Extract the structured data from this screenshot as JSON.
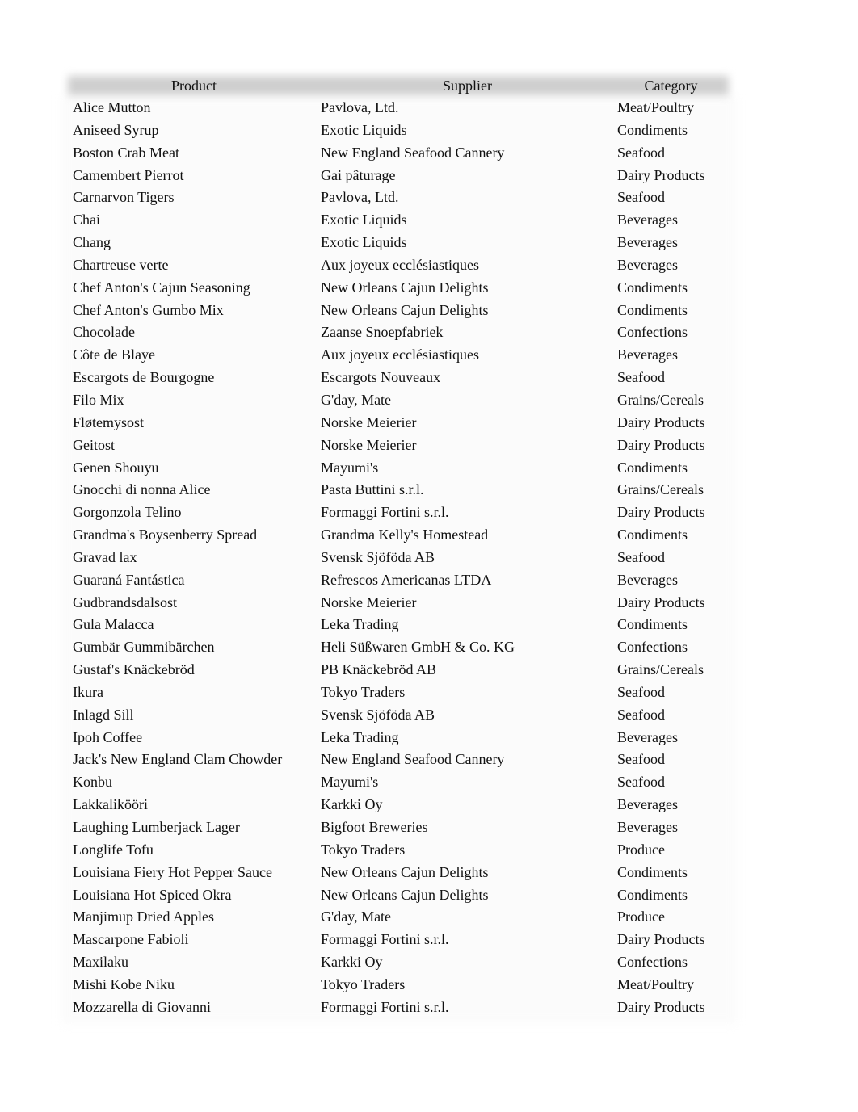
{
  "table": {
    "headers": [
      "Product",
      "Supplier",
      "Category"
    ],
    "rows": [
      [
        "Alice Mutton",
        "Pavlova, Ltd.",
        "Meat/Poultry"
      ],
      [
        "Aniseed Syrup",
        "Exotic Liquids",
        "Condiments"
      ],
      [
        "Boston Crab Meat",
        "New England Seafood Cannery",
        "Seafood"
      ],
      [
        "Camembert Pierrot",
        "Gai pâturage",
        "Dairy Products"
      ],
      [
        "Carnarvon Tigers",
        "Pavlova, Ltd.",
        "Seafood"
      ],
      [
        "Chai",
        "Exotic Liquids",
        "Beverages"
      ],
      [
        "Chang",
        "Exotic Liquids",
        "Beverages"
      ],
      [
        "Chartreuse verte",
        "Aux joyeux ecclésiastiques",
        "Beverages"
      ],
      [
        "Chef Anton's Cajun Seasoning",
        "New Orleans Cajun Delights",
        "Condiments"
      ],
      [
        "Chef Anton's Gumbo Mix",
        "New Orleans Cajun Delights",
        "Condiments"
      ],
      [
        "Chocolade",
        "Zaanse Snoepfabriek",
        "Confections"
      ],
      [
        "Côte de Blaye",
        "Aux joyeux ecclésiastiques",
        "Beverages"
      ],
      [
        "Escargots de Bourgogne",
        "Escargots Nouveaux",
        "Seafood"
      ],
      [
        "Filo Mix",
        "G'day, Mate",
        "Grains/Cereals"
      ],
      [
        "Fløtemysost",
        "Norske Meierier",
        "Dairy Products"
      ],
      [
        "Geitost",
        "Norske Meierier",
        "Dairy Products"
      ],
      [
        "Genen Shouyu",
        "Mayumi's",
        "Condiments"
      ],
      [
        "Gnocchi di nonna Alice",
        "Pasta Buttini s.r.l.",
        "Grains/Cereals"
      ],
      [
        "Gorgonzola Telino",
        "Formaggi Fortini s.r.l.",
        "Dairy Products"
      ],
      [
        "Grandma's Boysenberry Spread",
        "Grandma Kelly's Homestead",
        "Condiments"
      ],
      [
        "Gravad lax",
        "Svensk Sjöföda AB",
        "Seafood"
      ],
      [
        "Guaraná Fantástica",
        "Refrescos Americanas LTDA",
        "Beverages"
      ],
      [
        "Gudbrandsdalsost",
        "Norske Meierier",
        "Dairy Products"
      ],
      [
        "Gula Malacca",
        "Leka Trading",
        "Condiments"
      ],
      [
        "Gumbär Gummibärchen",
        "Heli Süßwaren GmbH & Co. KG",
        "Confections"
      ],
      [
        "Gustaf's Knäckebröd",
        "PB Knäckebröd AB",
        "Grains/Cereals"
      ],
      [
        "Ikura",
        "Tokyo Traders",
        "Seafood"
      ],
      [
        "Inlagd Sill",
        "Svensk Sjöföda AB",
        "Seafood"
      ],
      [
        "Ipoh Coffee",
        "Leka Trading",
        "Beverages"
      ],
      [
        "Jack's New England Clam Chowder",
        "New England Seafood Cannery",
        "Seafood"
      ],
      [
        "Konbu",
        "Mayumi's",
        "Seafood"
      ],
      [
        "Lakkalikööri",
        "Karkki Oy",
        "Beverages"
      ],
      [
        "Laughing Lumberjack Lager",
        "Bigfoot Breweries",
        "Beverages"
      ],
      [
        "Longlife Tofu",
        "Tokyo Traders",
        "Produce"
      ],
      [
        "Louisiana Fiery Hot Pepper Sauce",
        "New Orleans Cajun Delights",
        "Condiments"
      ],
      [
        "Louisiana Hot Spiced Okra",
        "New Orleans Cajun Delights",
        "Condiments"
      ],
      [
        "Manjimup Dried Apples",
        "G'day, Mate",
        "Produce"
      ],
      [
        "Mascarpone Fabioli",
        "Formaggi Fortini s.r.l.",
        "Dairy Products"
      ],
      [
        "Maxilaku",
        "Karkki Oy",
        "Confections"
      ],
      [
        "Mishi Kobe Niku",
        "Tokyo Traders",
        "Meat/Poultry"
      ],
      [
        "Mozzarella di Giovanni",
        "Formaggi Fortini s.r.l.",
        "Dairy Products"
      ]
    ]
  }
}
